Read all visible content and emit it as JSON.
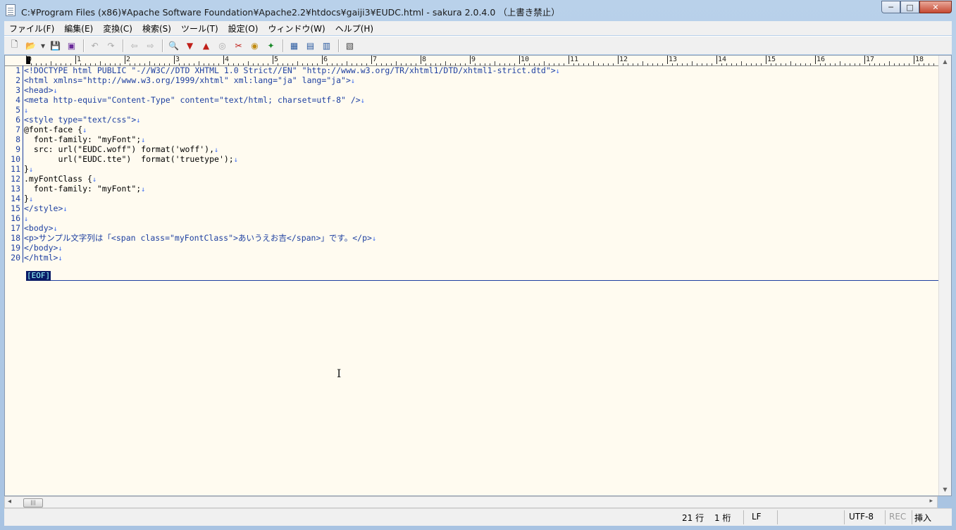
{
  "window": {
    "title": "C:¥Program Files (x86)¥Apache Software Foundation¥Apache2.2¥htdocs¥gaiji3¥EUDC.html - sakura 2.0.4.0 （上書き禁止）",
    "minimize_label": "─",
    "maximize_label": "□",
    "close_label": "✕"
  },
  "menu": {
    "items": [
      "ファイル(F)",
      "編集(E)",
      "変換(C)",
      "検索(S)",
      "ツール(T)",
      "設定(O)",
      "ウィンドウ(W)",
      "ヘルプ(H)"
    ]
  },
  "toolbar": {
    "buttons": [
      {
        "name": "new-file-icon",
        "glyph": "🗋"
      },
      {
        "name": "open-folder-icon",
        "glyph": "📂"
      },
      {
        "name": "dropdown-arrow-icon",
        "glyph": "▾"
      },
      {
        "name": "save-icon",
        "glyph": "💾"
      },
      {
        "name": "save-all-icon",
        "glyph": "▣"
      },
      {
        "name": "undo-icon",
        "glyph": "↶"
      },
      {
        "name": "redo-icon",
        "glyph": "↷"
      },
      {
        "name": "back-icon",
        "glyph": "⇦"
      },
      {
        "name": "forward-icon",
        "glyph": "⇨"
      },
      {
        "name": "search-icon",
        "glyph": "🔍"
      },
      {
        "name": "search-down-icon",
        "glyph": "▼"
      },
      {
        "name": "search-up-icon",
        "glyph": "▲"
      },
      {
        "name": "search-mark-icon",
        "glyph": "◎"
      },
      {
        "name": "replace-icon",
        "glyph": "✂"
      },
      {
        "name": "grep-icon",
        "glyph": "◉"
      },
      {
        "name": "jump-icon",
        "glyph": "✦"
      },
      {
        "name": "outline-icon",
        "glyph": "▦"
      },
      {
        "name": "macro-icon",
        "glyph": "▤"
      },
      {
        "name": "macro-play-icon",
        "glyph": "▥"
      },
      {
        "name": "settings-icon",
        "glyph": "▧"
      }
    ]
  },
  "ruler": {
    "labels": [
      "0",
      "1",
      "2",
      "3",
      "4",
      "5",
      "6",
      "7",
      "8",
      "9",
      "10",
      "11",
      "12",
      "13",
      "14",
      "15",
      "16",
      "17",
      "18"
    ]
  },
  "code_lines": [
    {
      "n": "1",
      "text": "<!DOCTYPE html PUBLIC \"-//W3C//DTD XHTML 1.0 Strict//EN\" \"http://www.w3.org/TR/xhtml1/DTD/xhtml1-strict.dtd\">"
    },
    {
      "n": "2",
      "text": "<html xmlns=\"http://www.w3.org/1999/xhtml\" xml:lang=\"ja\" lang=\"ja\">"
    },
    {
      "n": "3",
      "text": "<head>"
    },
    {
      "n": "4",
      "text": "<meta http-equiv=\"Content-Type\" content=\"text/html; charset=utf-8\" />"
    },
    {
      "n": "5",
      "text": ""
    },
    {
      "n": "6",
      "text": "<style type=\"text/css\">"
    },
    {
      "n": "7",
      "text": "@font-face {"
    },
    {
      "n": "8",
      "text": "  font-family: \"myFont\";"
    },
    {
      "n": "9",
      "text": "  src: url(\"EUDC.woff\") format('woff'),"
    },
    {
      "n": "10",
      "text": "       url(\"EUDC.tte\")  format('truetype');"
    },
    {
      "n": "11",
      "text": "}"
    },
    {
      "n": "12",
      "text": ".myFontClass {"
    },
    {
      "n": "13",
      "text": "  font-family: \"myFont\";"
    },
    {
      "n": "14",
      "text": "}"
    },
    {
      "n": "15",
      "text": "</style>"
    },
    {
      "n": "16",
      "text": ""
    },
    {
      "n": "17",
      "text": "<body>"
    },
    {
      "n": "18",
      "text": "<p>サンプル文字列は「<span class=\"myFontClass\">あいうえお吉</span>」です。</p>"
    },
    {
      "n": "19",
      "text": "</body>"
    },
    {
      "n": "20",
      "text": "</html>"
    }
  ],
  "newline_marker": "↓",
  "eof_label": "[EOF]",
  "status": {
    "line": "21 行",
    "column": "1 桁",
    "eol": "LF",
    "encoding": "UTF-8",
    "rec": "REC",
    "insert_mode": "挿入"
  },
  "colors": {
    "editor_bg": "#fffbf0",
    "tag": "#1d3fa0",
    "string": "#9a2a8a",
    "eof_bg": "#0a1a66"
  }
}
